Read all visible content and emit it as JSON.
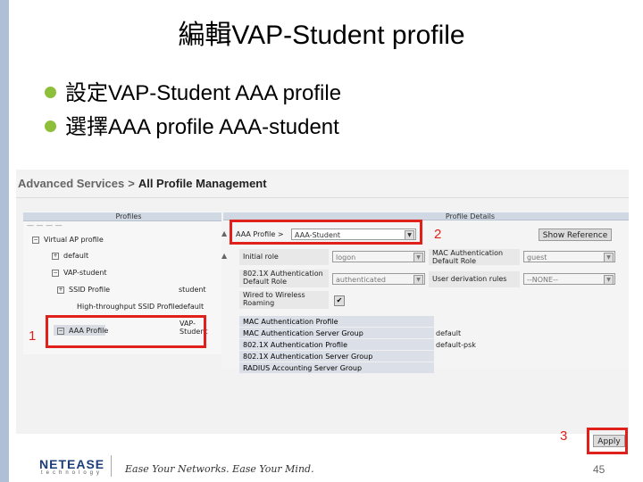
{
  "slide": {
    "title": "編輯VAP-Student profile",
    "bullets": [
      "設定VAP-Student  AAA profile",
      "選擇AAA profile  AAA-student"
    ],
    "page_number": "45"
  },
  "breadcrumb": {
    "parent": "Advanced Services",
    "separator": ">",
    "current": "All Profile Management"
  },
  "profiles_panel": {
    "header": "Profiles",
    "rows": [
      {
        "label": "Virtual AP profile",
        "value": ""
      },
      {
        "label": "default",
        "value": ""
      },
      {
        "label": "VAP-student",
        "value": ""
      },
      {
        "label": "SSID Profile",
        "value": "student"
      },
      {
        "label": "High-throughput SSID Profile",
        "value": "default"
      },
      {
        "label": "AAA Profile",
        "value": "VAP-Student"
      }
    ]
  },
  "profile_details": {
    "header": "Profile Details",
    "aaa_profile_label": "AAA Profile >",
    "aaa_profile_value": "AAA-Student",
    "show_reference_label": "Show Reference",
    "initial_role_label": "Initial role",
    "initial_role_value": "logon",
    "mac_auth_default_role_label": "MAC Authentication Default Role",
    "mac_auth_default_role_value": "guest",
    "dot1x_default_role_label": "802.1X Authentication Default Role",
    "dot1x_default_role_value": "authenticated",
    "user_derivation_label": "User derivation rules",
    "user_derivation_value": "--NONE--",
    "wired_to_wireless_label": "Wired to Wireless Roaming",
    "wired_to_wireless_checked": "✔",
    "list_rows": [
      {
        "label": "MAC Authentication Profile",
        "value": ""
      },
      {
        "label": "MAC Authentication Server Group",
        "value": "default"
      },
      {
        "label": "802.1X Authentication Profile",
        "value": "default-psk"
      },
      {
        "label": "802.1X Authentication Server Group",
        "value": ""
      },
      {
        "label": "RADIUS Accounting Server Group",
        "value": ""
      }
    ],
    "apply_label": "Apply"
  },
  "markers": {
    "one": "1",
    "two": "2",
    "three": "3"
  },
  "footer": {
    "logo": "NETEASE",
    "logo_sub": "technology",
    "tagline": "Ease Your Networks. Ease Your Mind."
  },
  "colors": {
    "accent_bullet": "#8dbf3a",
    "highlight": "#e0201b",
    "brand": "#1c3c7a"
  }
}
